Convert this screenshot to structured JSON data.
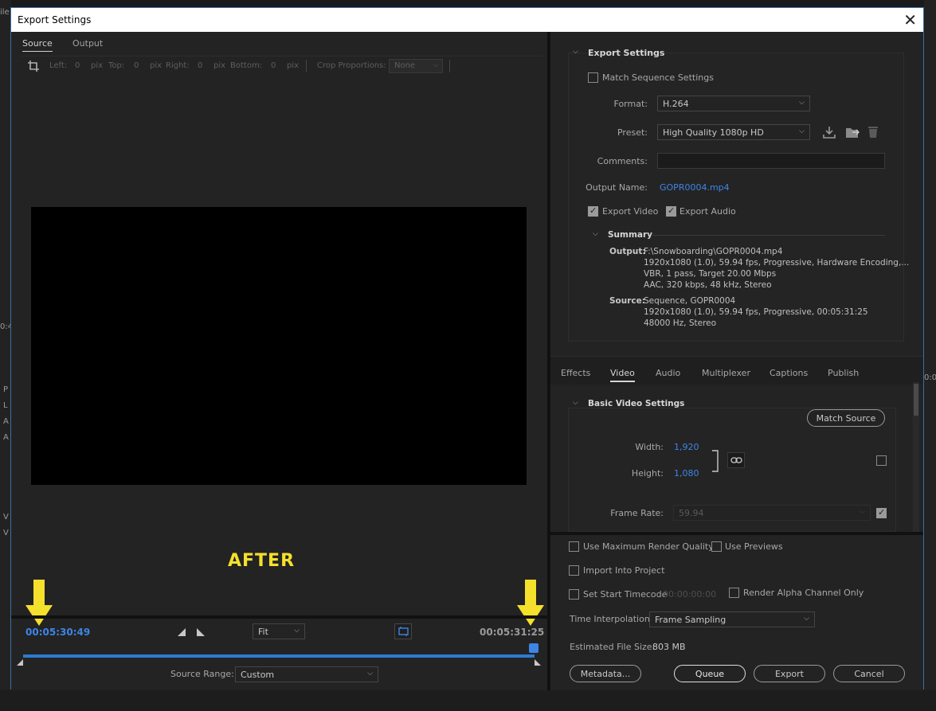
{
  "dialog": {
    "title": "Export Settings",
    "close_glyph": "✕"
  },
  "background": {
    "top_left_fragment": "ile",
    "left_timecode_fragment": "0:4",
    "left_items": [
      "P",
      "L",
      "A",
      "A",
      "V",
      "V"
    ],
    "right_timecode_fragment": "0:0"
  },
  "left_pane": {
    "tabs": [
      "Source",
      "Output"
    ],
    "active_tab": "Source",
    "crop": {
      "left_label": "Left:",
      "left_value": "0",
      "top_label": "Top:",
      "top_value": "0",
      "right_label": "Right:",
      "right_value": "0",
      "bottom_label": "Bottom:",
      "bottom_value": "0",
      "unit": "pix",
      "proportions_label": "Crop Proportions:",
      "proportions_value": "None"
    },
    "overlay_text": "AFTER",
    "timecode_in": "00:05:30:49",
    "timecode_out": "00:05:31:25",
    "zoom_value": "Fit",
    "source_range_label": "Source Range:",
    "source_range_value": "Custom",
    "annotation_color": "#f5e02b",
    "accent_color": "#3d85e6"
  },
  "export_settings": {
    "section_title": "Export Settings",
    "match_sequence_label": "Match Sequence Settings",
    "match_sequence_checked": false,
    "format_label": "Format:",
    "format_value": "H.264",
    "preset_label": "Preset:",
    "preset_value": "High Quality 1080p HD",
    "comments_label": "Comments:",
    "comments_value": "",
    "output_name_label": "Output Name:",
    "output_name_value": "GOPR0004.mp4",
    "export_video_label": "Export Video",
    "export_video_checked": true,
    "export_audio_label": "Export Audio",
    "export_audio_checked": true
  },
  "summary": {
    "title": "Summary",
    "output_label": "Output:",
    "output_lines": [
      "F:\\Snowboarding\\GOPR0004.mp4",
      "1920x1080 (1.0), 59.94 fps, Progressive, Hardware Encoding,...",
      "VBR, 1 pass, Target 20.00 Mbps",
      "AAC, 320 kbps, 48 kHz, Stereo"
    ],
    "source_label": "Source:",
    "source_lines": [
      "Sequence, GOPR0004",
      "1920x1080 (1.0), 59.94 fps, Progressive, 00:05:31:25",
      "48000 Hz, Stereo"
    ]
  },
  "settings_tabs": [
    "Effects",
    "Video",
    "Audio",
    "Multiplexer",
    "Captions",
    "Publish"
  ],
  "active_settings_tab": "Video",
  "video": {
    "section_title": "Basic Video Settings",
    "match_source_label": "Match Source",
    "width_label": "Width:",
    "width_value": "1,920",
    "height_label": "Height:",
    "height_value": "1,080",
    "frame_rate_label": "Frame Rate:",
    "frame_rate_value": "59.94"
  },
  "bottom": {
    "max_render_label": "Use Maximum Render Quality",
    "use_previews_label": "Use Previews",
    "import_project_label": "Import Into Project",
    "set_start_tc_label": "Set Start Timecode",
    "start_tc_value": "00:00:00:00",
    "render_alpha_label": "Render Alpha Channel Only",
    "time_interp_label": "Time Interpolation:",
    "time_interp_value": "Frame Sampling",
    "file_size_label": "Estimated File Size:",
    "file_size_value": "803 MB",
    "metadata_label": "Metadata...",
    "queue_label": "Queue",
    "export_label": "Export",
    "cancel_label": "Cancel"
  }
}
